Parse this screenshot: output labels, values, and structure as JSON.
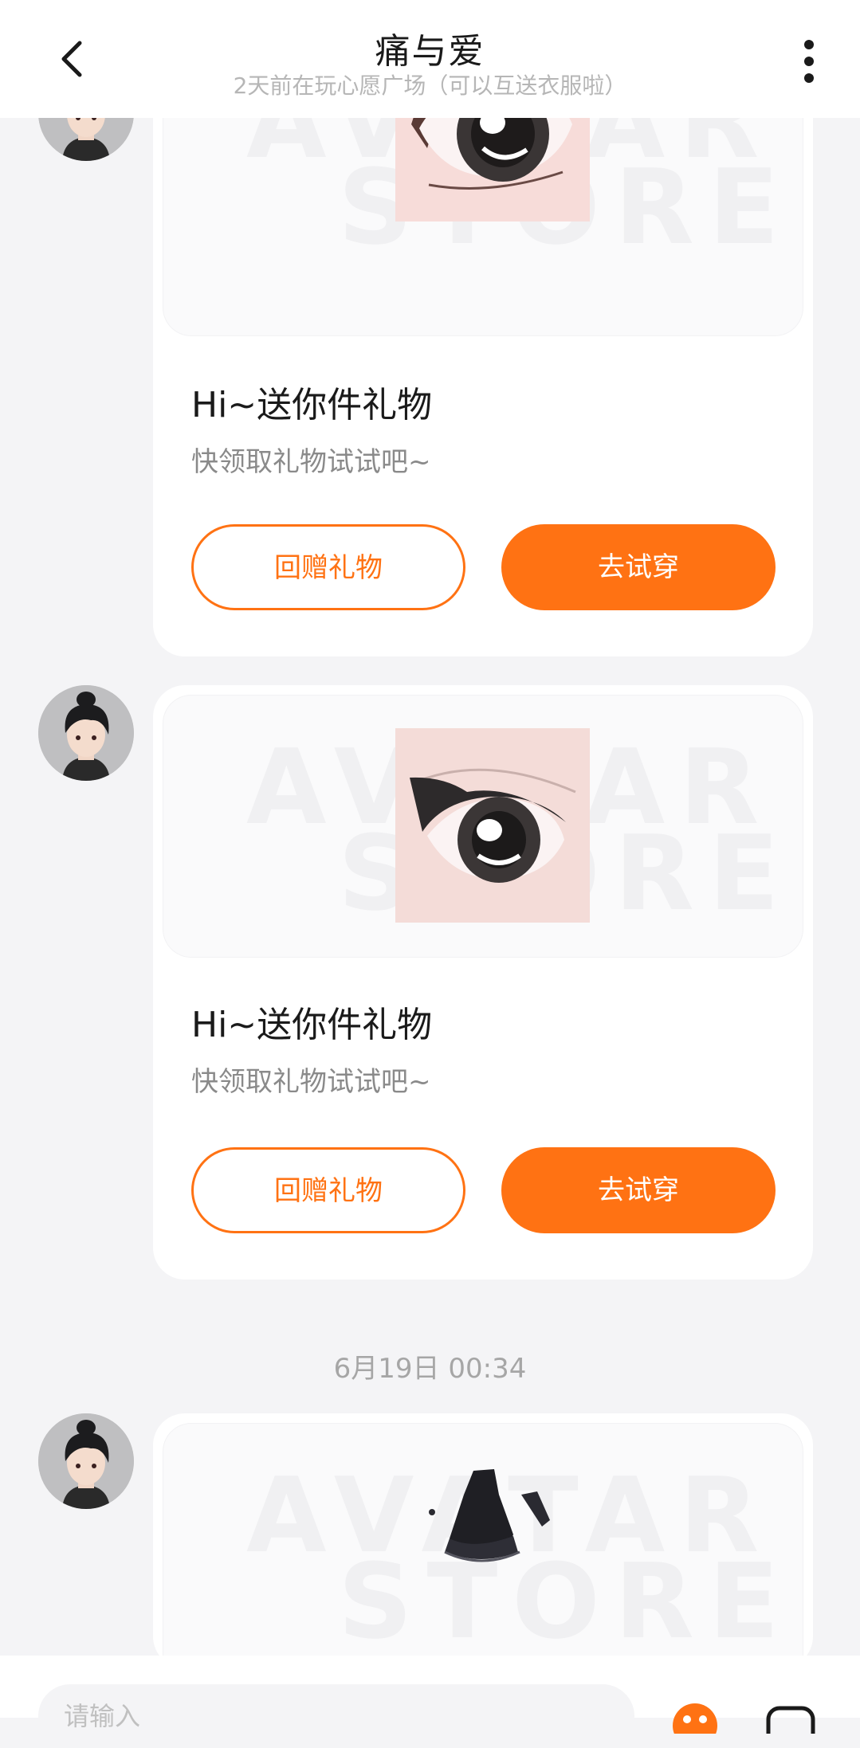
{
  "header": {
    "title": "痛与爱",
    "subtitle": "2天前在玩心愿广场（可以互送衣服啦）"
  },
  "watermark": [
    "AVATAR",
    "STORE"
  ],
  "messages": [
    {
      "item": "eye-style-1",
      "title": "Hi~送你件礼物",
      "desc": "快领取礼物试试吧~",
      "return_label": "回赠礼物",
      "try_label": "去试穿"
    },
    {
      "item": "eye-style-2",
      "title": "Hi~送你件礼物",
      "desc": "快领取礼物试试吧~",
      "return_label": "回赠礼物",
      "try_label": "去试穿"
    },
    {
      "item": "black-lace-dress"
    }
  ],
  "timestamp": "6月19日 00:34",
  "input": {
    "placeholder": "请输入"
  },
  "colors": {
    "accent": "#ff7213",
    "background": "#f4f4f6"
  }
}
